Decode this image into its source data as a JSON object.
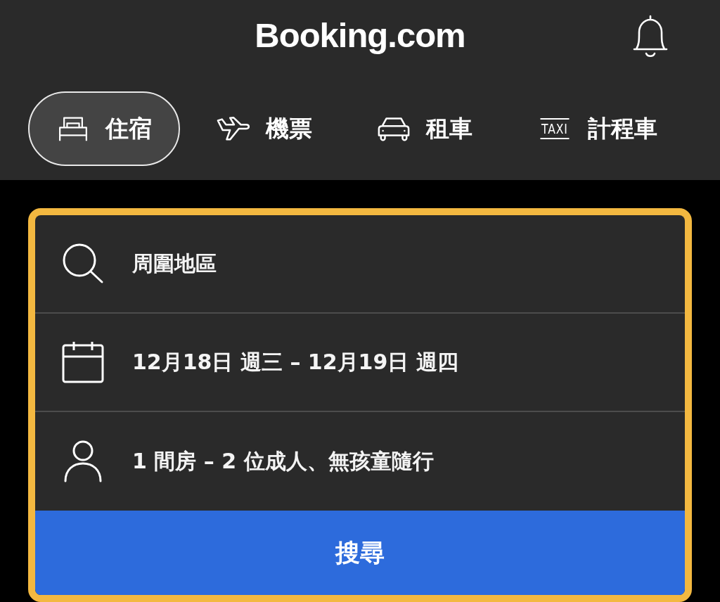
{
  "header": {
    "logo": "Booking.com"
  },
  "tabs": [
    {
      "kind": "stays",
      "label": "住宿",
      "selected": true
    },
    {
      "kind": "flights",
      "label": "機票",
      "selected": false
    },
    {
      "kind": "rentals",
      "label": "租車",
      "selected": false
    },
    {
      "kind": "taxis",
      "label": "計程車",
      "sign": "TAXI",
      "selected": false
    }
  ],
  "search_form": {
    "fields": [
      {
        "kind": "destination",
        "value": "周圍地區"
      },
      {
        "kind": "dates",
        "value": "12月18日 週三 – 12月19日 週四"
      },
      {
        "kind": "guests",
        "value": "1 間房 – 2 位成人、無孩童隨行"
      }
    ],
    "button": "搜尋"
  }
}
